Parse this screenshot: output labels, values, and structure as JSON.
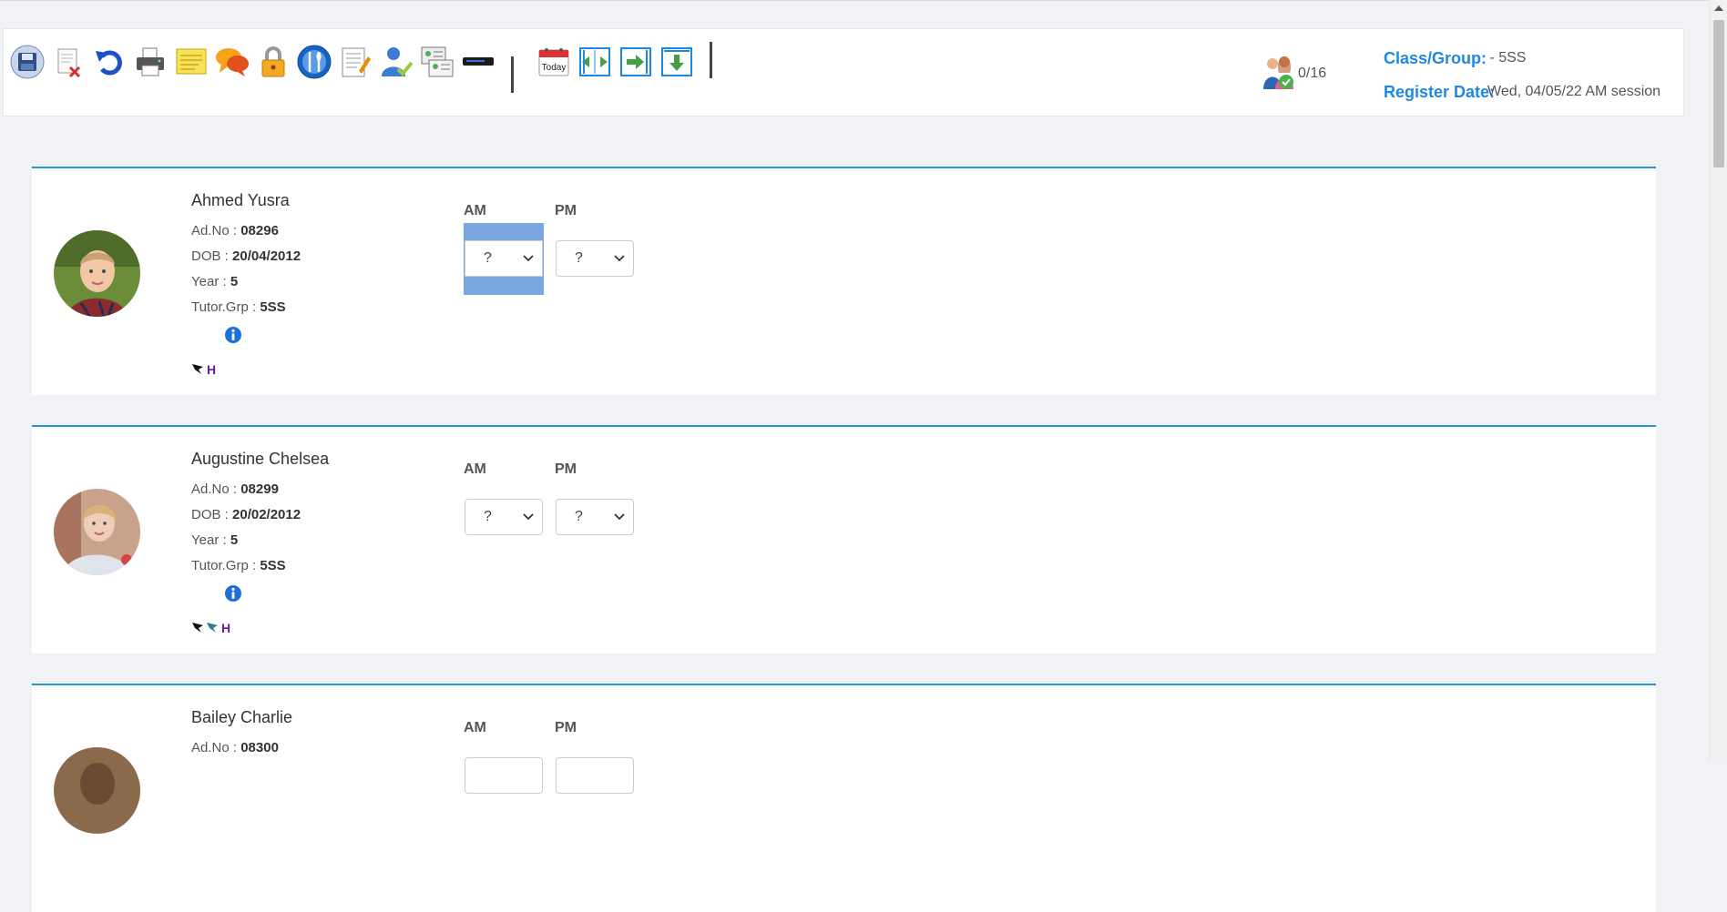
{
  "toolbar": {
    "buttons": [
      {
        "name": "save-icon"
      },
      {
        "name": "delete-register-icon"
      },
      {
        "name": "undo-icon"
      },
      {
        "name": "print-icon"
      },
      {
        "name": "notes-icon"
      },
      {
        "name": "comments-icon"
      },
      {
        "name": "lock-icon"
      },
      {
        "name": "meals-icon"
      },
      {
        "name": "report-icon"
      },
      {
        "name": "student-check-icon"
      },
      {
        "name": "contact-cards-icon"
      },
      {
        "name": "card-reader-icon"
      },
      {
        "name": "today-icon"
      },
      {
        "name": "collapse-icon"
      },
      {
        "name": "next-icon"
      },
      {
        "name": "download-icon"
      }
    ],
    "today_label": "Today",
    "attendance_count": "0/16",
    "class_group_label": "Class/Group:",
    "class_group_value": " - 5SS",
    "register_date_label": "Register Date:",
    "register_date_value": "Wed, 04/05/22 AM session"
  },
  "students": [
    {
      "name": "Ahmed Yusra",
      "adno_label": "Ad.No : ",
      "adno": "08296",
      "dob_label": "DOB : ",
      "dob": "20/04/2012",
      "year_label": "Year : ",
      "year": "5",
      "tutor_label": "Tutor.Grp : ",
      "tutor": "5SS",
      "h_mark": "H",
      "am_label": "AM",
      "pm_label": "PM",
      "am_value": "?",
      "pm_value": "?"
    },
    {
      "name": "Augustine Chelsea",
      "adno_label": "Ad.No : ",
      "adno": "08299",
      "dob_label": "DOB : ",
      "dob": "20/02/2012",
      "year_label": "Year : ",
      "year": "5",
      "tutor_label": "Tutor.Grp : ",
      "tutor": "5SS",
      "h_mark": "H",
      "am_label": "AM",
      "pm_label": "PM",
      "am_value": "?",
      "pm_value": "?"
    },
    {
      "name": "Bailey Charlie",
      "adno_label": "Ad.No : ",
      "adno": "08300",
      "am_label": "AM",
      "pm_label": "PM"
    }
  ],
  "colors": {
    "accent": "#1e88e5",
    "card_border": "#2196d3",
    "highlight": "#7ba7e0",
    "h_mark": "#6a1b9a"
  }
}
